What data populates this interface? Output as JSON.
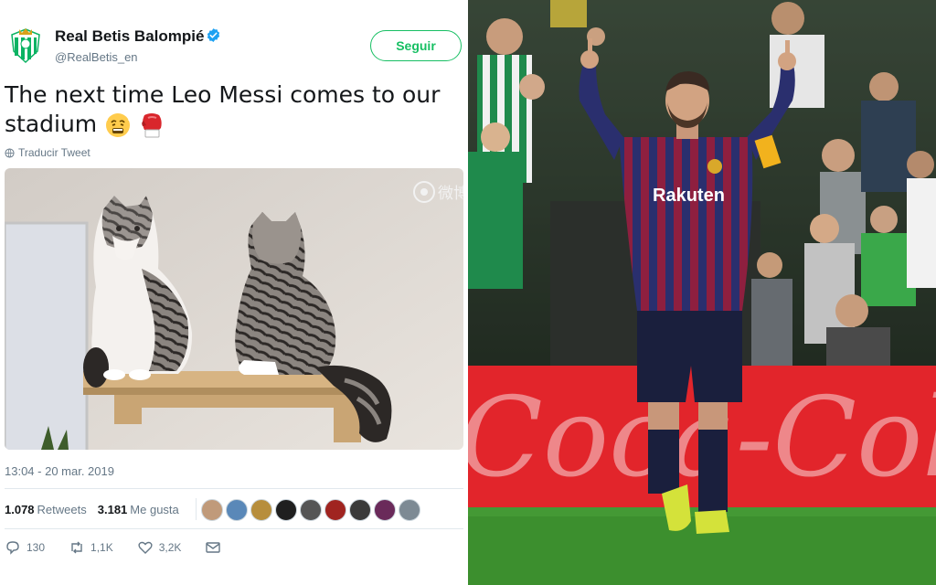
{
  "tweet": {
    "account_name": "Real Betis Balompié",
    "handle": "@RealBetis_en",
    "follow_label": "Seguir",
    "text_line1": "The next time Leo Messi comes to our",
    "text_line2": "stadium",
    "emoji": [
      "weary-face-emoji",
      "boxing-glove-emoji"
    ],
    "translate_label": "Traducir Tweet",
    "media_watermark": "微博",
    "timestamp": "13:04 - 20 mar. 2019",
    "retweets_count": "1.078",
    "retweets_label": "Retweets",
    "likes_count": "3.181",
    "likes_label": "Me gusta",
    "liker_count": 9,
    "actions": {
      "reply_count": "130",
      "retweet_count": "1,1K",
      "like_count": "3,2K"
    }
  },
  "photo": {
    "shirt_sponsor": "Rakuten",
    "ad_board_text": "Coca-Cola"
  },
  "colors": {
    "follow_green": "#17bf63",
    "verified_blue": "#1da1f2",
    "muted_text": "#657786",
    "betis_green": "#0bb363",
    "ad_board_red": "#e2252b",
    "pitch_green": "#3c8f2e"
  }
}
